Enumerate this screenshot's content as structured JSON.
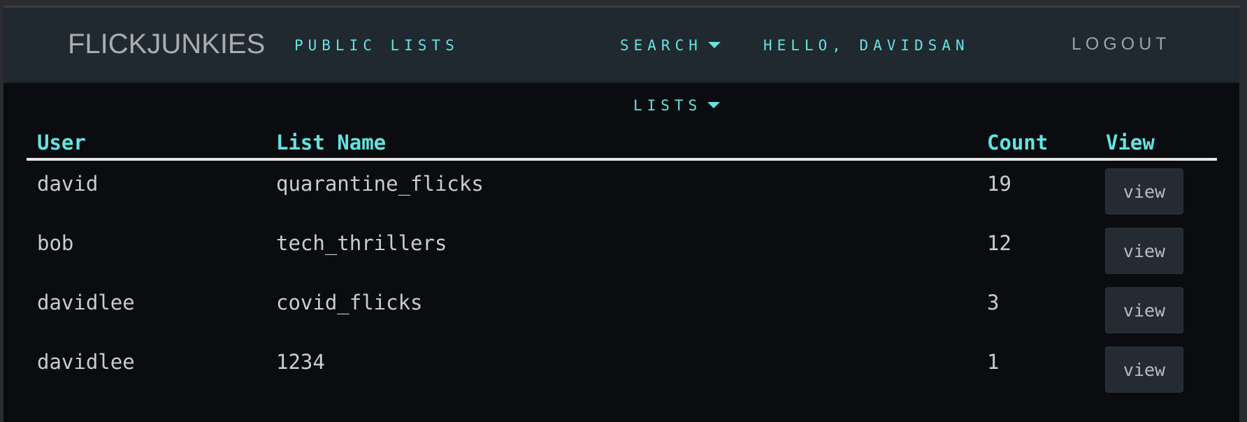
{
  "header": {
    "brand": "FLICKJUNKIES",
    "public_lists": "PUBLIC LISTS",
    "search": "SEARCH",
    "greeting": "HELLO, DAVIDSAN",
    "logout": "LOGOUT"
  },
  "lists_menu": {
    "label": "LISTS"
  },
  "table": {
    "headers": {
      "user": "User",
      "list_name": "List Name",
      "count": "Count",
      "view": "View"
    },
    "rows": [
      {
        "user": "david",
        "list_name": "quarantine_flicks",
        "count": "19",
        "view": "view"
      },
      {
        "user": "bob",
        "list_name": "tech_thrillers",
        "count": "12",
        "view": "view"
      },
      {
        "user": "davidlee",
        "list_name": "covid_flicks",
        "count": "3",
        "view": "view"
      },
      {
        "user": "davidlee",
        "list_name": "1234",
        "count": "1",
        "view": "view"
      }
    ]
  },
  "colors": {
    "accent": "#64e3e0",
    "navbar_bg": "#202830",
    "page_bg": "#0a0c0f",
    "text": "#c9cdd0"
  }
}
